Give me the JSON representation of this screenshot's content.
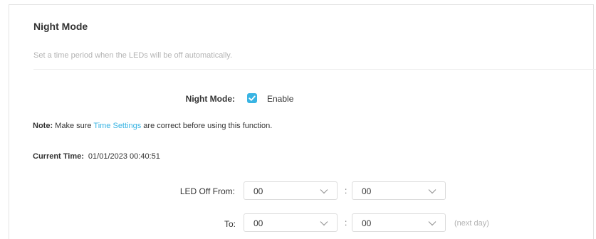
{
  "section": {
    "title": "Night Mode",
    "subtitle": "Set a time period when the LEDs will be off automatically."
  },
  "night_mode": {
    "label": "Night Mode:",
    "checkbox_checked": true,
    "checkbox_color": "#39b4e3",
    "enable_label": "Enable"
  },
  "note": {
    "prefix": "Note:",
    "text_before": " Make sure ",
    "link": "Time Settings",
    "text_after": " are correct before using this function."
  },
  "current_time": {
    "label": "Current Time:",
    "value": "01/01/2023 00:40:51"
  },
  "led_off_from": {
    "label": "LED Off From:",
    "hour": "00",
    "separator": ":",
    "minute": "00"
  },
  "led_off_to": {
    "label": "To:",
    "hour": "00",
    "separator": ":",
    "minute": "00",
    "hint": "(next day)"
  },
  "icons": {
    "dropdown": "chevron-down-icon",
    "checkbox": "checkmark-icon"
  }
}
